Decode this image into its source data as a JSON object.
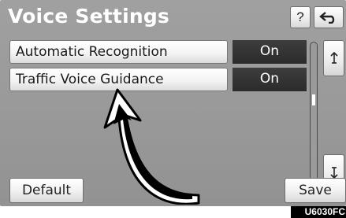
{
  "header": {
    "title": "Voice Settings",
    "help_label": "?",
    "back_icon": "back-return-icon"
  },
  "settings": [
    {
      "label": "Automatic Recognition",
      "value": "On"
    },
    {
      "label": "Traffic Voice Guidance",
      "value": "On"
    }
  ],
  "scroll": {
    "up_icon": "scroll-up-icon",
    "down_icon": "scroll-down-icon"
  },
  "footer": {
    "default_label": "Default",
    "save_label": "Save"
  },
  "figure_code": "U6030FC",
  "colors": {
    "screen_bg": "#9a9a9a",
    "value_bg": "#2f2f2f",
    "title_text": "#ffffff"
  }
}
